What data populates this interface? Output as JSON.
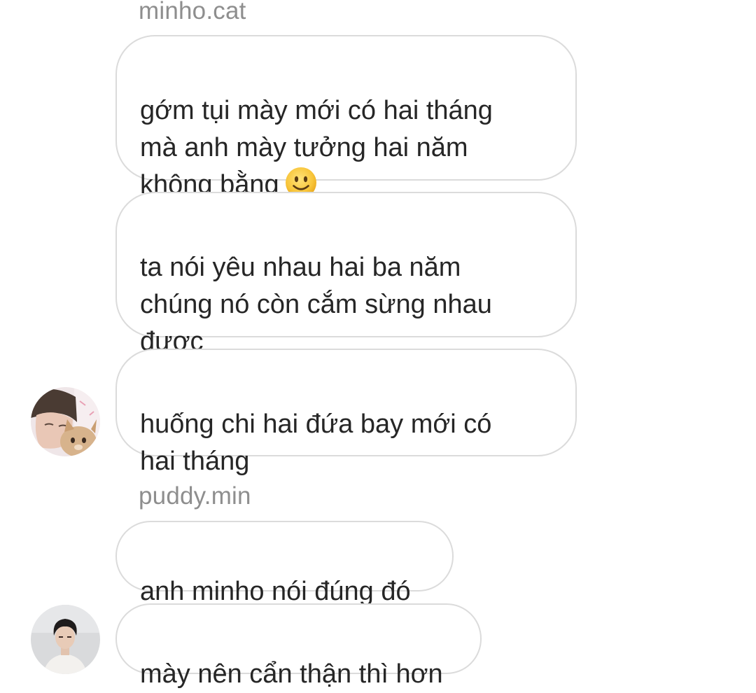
{
  "chat": {
    "groups": [
      {
        "sender": "minho.cat",
        "messages": [
          "gớm tụi mày mới có hai tháng\nmà anh mày tưởng hai năm\nkhông bằng",
          "ta nói yêu nhau hai ba năm\nchúng nó còn cắm sừng nhau\nđược",
          "huống chi hai đứa bay mới có\nhai tháng"
        ],
        "emoji": "slightly-smiling-face",
        "avatar": "minho-cat-avatar"
      },
      {
        "sender": "puddy.min",
        "messages": [
          "anh minho nói đúng đó",
          "mày nên cẩn thận thì hơn"
        ],
        "avatar": "puddy-min-avatar"
      }
    ]
  },
  "colors": {
    "bubble_border": "#dbdbdb",
    "text": "#262626",
    "sender_name": "#8e8e8e",
    "emoji": "#f5c33b"
  }
}
